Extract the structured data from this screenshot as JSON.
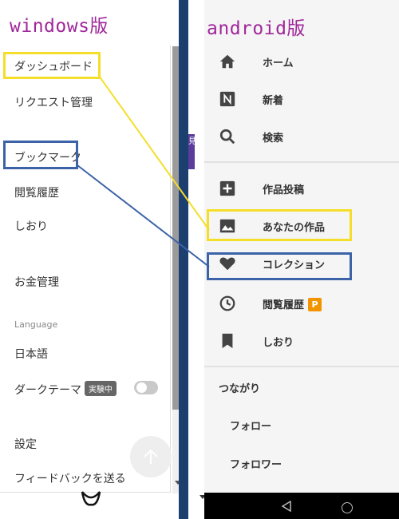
{
  "windows": {
    "title": "windows版",
    "menu": {
      "dashboard": "ダッシュボード",
      "requests": "リクエスト管理",
      "bookmarks": "ブックマーク",
      "history": "閲覧履歴",
      "shiori": "しおり",
      "money": "お金管理",
      "language_header": "Language",
      "language_value": "日本語",
      "dark_theme": "ダークテーマ",
      "dark_theme_badge": "実験中",
      "dark_theme_enabled": false,
      "settings": "設定",
      "feedback": "フィードバックを送る"
    }
  },
  "android": {
    "title": "android版",
    "menu": {
      "home": "ホーム",
      "new": "新着",
      "search": "検索",
      "post": "作品投稿",
      "your_works": "あなたの作品",
      "collection": "コレクション",
      "history": "閲覧履歴",
      "history_badge": "P",
      "shiori": "しおり",
      "connections_header": "つながり",
      "follow": "フォロー",
      "followers": "フォロワー"
    },
    "side_tab_letter": "見"
  },
  "colors": {
    "title": "#a0279a",
    "highlight_yellow": "#f5de2a",
    "highlight_blue": "#3c63a8",
    "divider": "#1b3f6e",
    "badge_orange": "#f29400"
  },
  "icons": [
    "home-icon",
    "news-icon",
    "search-icon",
    "plus-icon",
    "image-icon",
    "heart-icon",
    "clock-icon",
    "bookmark-icon",
    "arrow-up-icon",
    "back-icon",
    "home-circle-icon"
  ]
}
